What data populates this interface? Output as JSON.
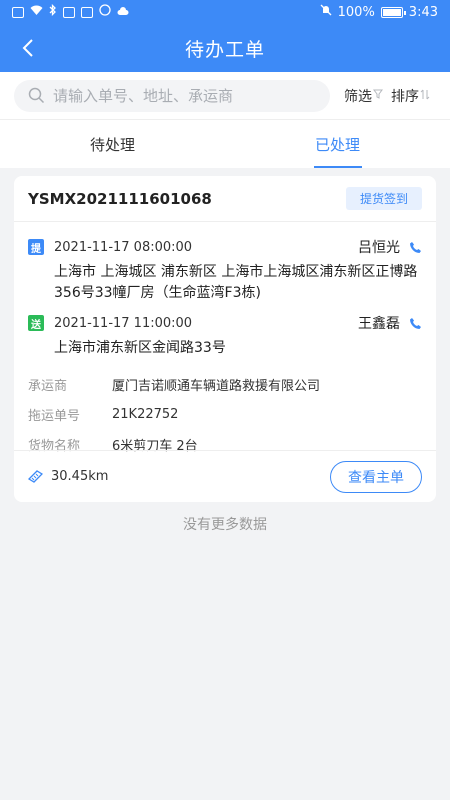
{
  "status_bar": {
    "battery": "100%",
    "time": "3:43"
  },
  "nav": {
    "title": "待办工单"
  },
  "search": {
    "placeholder": "请输入单号、地址、承运商",
    "filter_label": "筛选",
    "sort_label": "排序"
  },
  "tabs": [
    {
      "label": "待处理",
      "active": false
    },
    {
      "label": "已处理",
      "active": true
    }
  ],
  "order": {
    "number": "YSMX2021111601068",
    "status": "提货签到",
    "pickup": {
      "tag": "提",
      "time": "2021-11-17 08:00:00",
      "contact": "吕恒光",
      "address": "上海市 上海城区 浦东新区 上海市上海城区浦东新区正博路356号33幢厂房（生命蓝湾F3栋)"
    },
    "delivery": {
      "tag": "送",
      "time": "2021-11-17 11:00:00",
      "contact": "王鑫磊",
      "address": "上海市浦东新区金闻路33号"
    },
    "info": [
      {
        "label": "承运商",
        "value": "厦门吉诺顺通车辆道路救援有限公司"
      },
      {
        "label": "拖运单号",
        "value": "21K22752"
      },
      {
        "label": "货物名称",
        "value": "6米剪刀车 2台"
      }
    ],
    "distance": "30.45km",
    "view_button": "查看主单"
  },
  "footer": {
    "no_more": "没有更多数据"
  },
  "colors": {
    "primary": "#3d8af7",
    "deliver_tag": "#2bbb58"
  }
}
